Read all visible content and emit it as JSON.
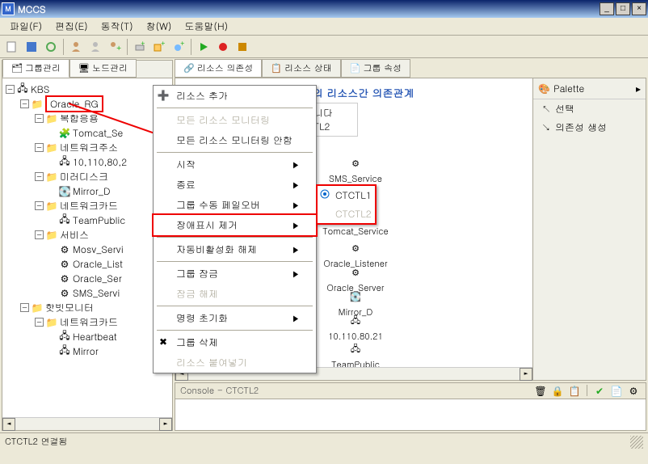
{
  "titlebar": {
    "icon_letter": "M",
    "title": "MCCS"
  },
  "menubar": {
    "file": "파일(F)",
    "edit": "편집(E)",
    "action": "동작(T)",
    "window": "창(W)",
    "help": "도움말(H)"
  },
  "left_tabs": {
    "group": "그룹관리",
    "node": "노드관리"
  },
  "tree": {
    "root": "KBS",
    "oracle_rg": "Oracle_RG",
    "composite_app": "복합응용",
    "tomcat": "Tomcat_Se",
    "network_addr": "네트워크주소",
    "ip": "10,110,80,2",
    "mirror_disk": "미러디스크",
    "mirror_d": "Mirror_D",
    "network_card": "네트워크카드",
    "teampublic": "TeamPublic",
    "service": "서비스",
    "mosv": "Mosv_Servi",
    "oracle_list": "Oracle_List",
    "oracle_serv": "Oracle_Ser",
    "sms_serv": "SMS_Servi",
    "hotbit": "핫빗모니터",
    "nw_card2": "네트워크카드",
    "heartbeat": "Heartbeat",
    "mirror": "Mirror"
  },
  "right_tabs": {
    "dependency": "리소스 의존성",
    "status": "리소스 상태",
    "groupattr": "그룹 속성"
  },
  "diagram": {
    "title_suffix": "의 리소스간 의존관계",
    "subtitle_label": "니다",
    "ctl2": "TL2",
    "nodes": {
      "sms": "SMS_Service",
      "ctctl1": "CTCTL1",
      "ctctl2": "CTCTL2",
      "tomcat": "Tomcat_Service",
      "oracle_listener": "Oracle_Listener",
      "oracle_server": "Oracle_Server",
      "mirror_d": "Mirror_D",
      "ip": "10.110.80.21",
      "teampublic": "TeamPublic"
    }
  },
  "palette": {
    "header": "Palette",
    "select": "선택",
    "dependency": "의존성 생성"
  },
  "context": {
    "add_resource": "리소스 추가",
    "monitor_all": "모든 리소스 모니터링",
    "monitor_none": "모든 리소스 모니터링 안함",
    "start": "시작",
    "stop": "종료",
    "manual_failover": "그룹 수동 페일오버",
    "clear_fault": "장애표시 제거",
    "auto_disable_off": "자동비활성화 해제",
    "group_lock": "그룹 잠금",
    "unlock": "잠금 해제",
    "init_cmd": "명령 초기화",
    "delete_group": "그룹 삭제",
    "paste_resource": "리소스 붙여넣기"
  },
  "submenu": {
    "ctctl1": "CTCTL1",
    "ctctl2": "CTCTL2"
  },
  "console": {
    "title": "Console - CTCTL2"
  },
  "statusbar": {
    "text": "CTCTL2 연결됨"
  }
}
